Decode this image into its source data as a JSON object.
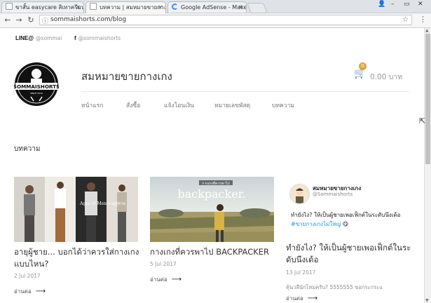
{
  "browser": {
    "tabs": [
      {
        "title": "ขาสั้น easycare สิเทาครีมนุ่มนิ่ม",
        "active": false
      },
      {
        "title": "บทความ | สมหมายขายกางเกง",
        "active": true
      },
      {
        "title": "Google AdSense - Make",
        "active": false
      }
    ],
    "url": "sommaishorts.com/blog",
    "window_controls": [
      "👤",
      "–",
      "▭",
      "✕"
    ]
  },
  "social": {
    "line_label": "LINE@",
    "line_handle": "@sommai",
    "fb_icon": "f",
    "fb_handle": "@sommaishorts"
  },
  "logo": {
    "text": "SOMMAISHORTS",
    "sub": "SINCE 2016"
  },
  "site": {
    "title": "สมหมายขายกางเกง"
  },
  "cart": {
    "count": "0",
    "total": "0.00 บาท"
  },
  "nav": {
    "items": [
      "หน้าแรก",
      "สั่งซื้อ",
      "แจ้งโอนเงิน",
      "หมายเลขพัสดุ",
      "บทความ"
    ]
  },
  "page": {
    "heading": "บทความ"
  },
  "posts": [
    {
      "title": "อายุผู้ชาย... บอกได้ว่าควรใส่กางเกงแบบไหน?",
      "date": "2 Jul 2017",
      "more": "อ่านต่อ",
      "overlay": "Ages of Men อายุผู้ชาย"
    },
    {
      "title": "กางเกงที่ควรพาไป BACKPACKER",
      "date": "5 Jul 2017",
      "more": "อ่านต่อ",
      "overlay_top": "กางเกงที่ควรพาไป",
      "overlay": "backpacker."
    },
    {
      "title": "ทำยังไง? ให้เป็นผู้ชายเพอเฟ็กต์ในระดับนึงเด้อ",
      "date": "13 Jul 2017",
      "excerpt": "คุ้นวลีนักไหมครับ? 5555555 ขอกระกระแ",
      "more": "อ่านต่อ"
    }
  ],
  "tweet": {
    "name": "สมหมายขายกางเกง",
    "handle": "@Sommaishorts",
    "text": "ทำยังไง? ให้เป็นผู้ชายเพอเฟ็กต์ในระดับนึงเด้อ",
    "hashtag": "#ขายกางเกงไม่ใหญ่",
    "emoji": "😋"
  },
  "colors": {
    "accent": "#d9a640",
    "hashtag": "#1b95e0",
    "text": "#333333"
  }
}
